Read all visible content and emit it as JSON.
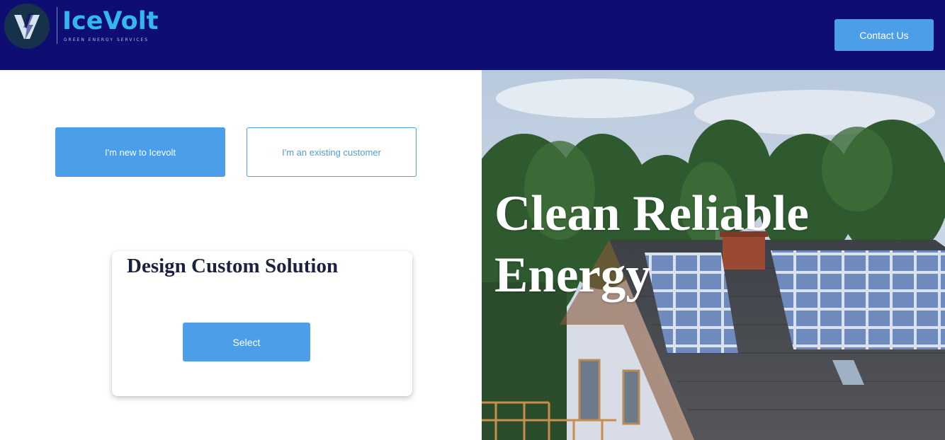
{
  "brand": {
    "name": "IceVolt",
    "tagline": "GREEN ENERGY SERVICES"
  },
  "header": {
    "contact_label": "Contact Us"
  },
  "options": {
    "new_label": "I'm new to Icevolt",
    "existing_label": "I'm an existing customer"
  },
  "card": {
    "title": "Design Custom Solution",
    "select_label": "Select"
  },
  "hero": {
    "line1": "Clean Reliable",
    "line2": "Energy"
  },
  "colors": {
    "header_bg": "#0e0d72",
    "accent": "#4c9ee8",
    "logo": "#34b6f2"
  }
}
